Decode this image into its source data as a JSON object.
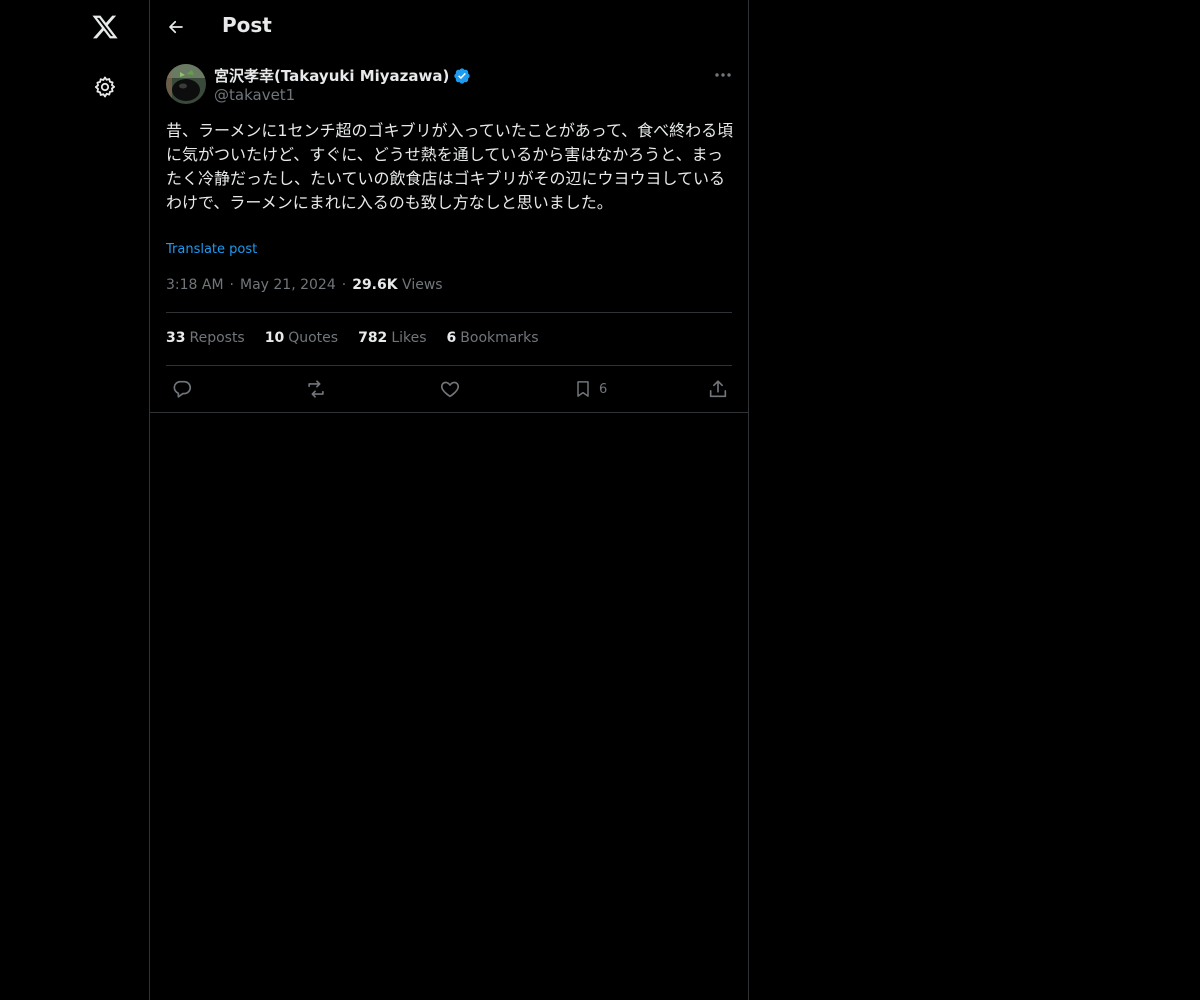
{
  "header": {
    "title": "Post"
  },
  "author": {
    "display_name": "宮沢孝幸(Takayuki Miyazawa)",
    "handle": "@takavet1",
    "verified": true
  },
  "post": {
    "text": "昔、ラーメンに1センチ超のゴキブリが入っていたことがあって、食べ終わる頃に気がついたけど、すぐに、どうせ熱を通しているから害はなかろうと、まったく冷静だったし、たいていの飲食店はゴキブリがその辺にウヨウヨしているわけで、ラーメンにまれに入るのも致し方なしと思いました。",
    "translate_label": "Translate post",
    "time": "3:18 AM",
    "date": "May 21, 2024",
    "views_count": "29.6K",
    "views_label": "Views",
    "separator": "·"
  },
  "stats": [
    {
      "count": "33",
      "label": "Reposts"
    },
    {
      "count": "10",
      "label": "Quotes"
    },
    {
      "count": "782",
      "label": "Likes"
    },
    {
      "count": "6",
      "label": "Bookmarks"
    }
  ],
  "actions": {
    "bookmark_count": "6"
  },
  "icons": {
    "logo": "x-logo-icon",
    "settings": "gear-icon",
    "back": "arrow-left-icon",
    "more": "more-horizontal-icon",
    "verified": "verified-badge-icon",
    "reply": "reply-icon",
    "repost": "repost-icon",
    "like": "heart-icon",
    "bookmark": "bookmark-icon",
    "share": "share-icon"
  },
  "colors": {
    "background": "#000000",
    "text": "#e7e9ea",
    "muted": "#71767b",
    "accent": "#1d9bf0",
    "border": "#2f3336"
  }
}
